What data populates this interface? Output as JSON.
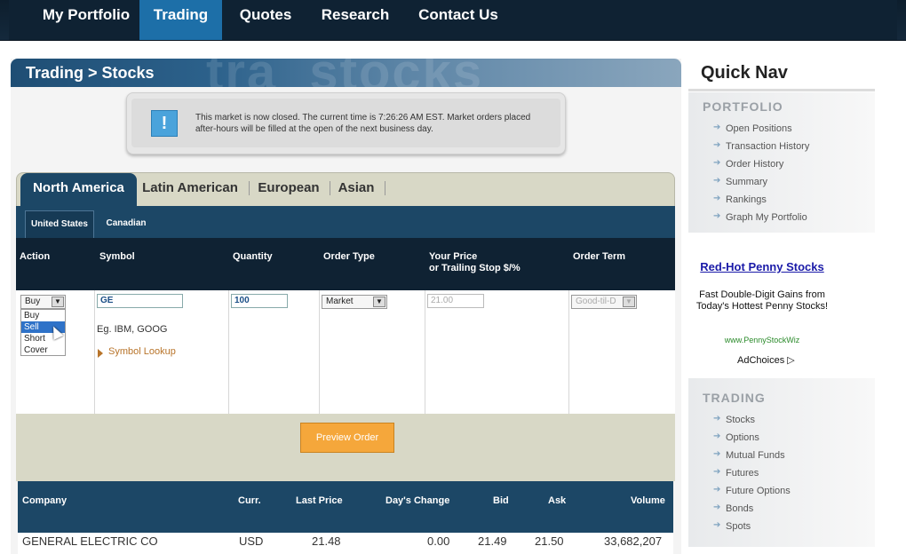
{
  "topnav": {
    "items": [
      {
        "label": "My Portfolio",
        "active": false
      },
      {
        "label": "Trading",
        "active": true
      },
      {
        "label": "Quotes",
        "active": false
      },
      {
        "label": "Research",
        "active": false
      },
      {
        "label": "Contact Us",
        "active": false
      }
    ]
  },
  "header": {
    "title": "Trading > Stocks"
  },
  "alert": {
    "icon": "!",
    "message": "This market is now closed. The current time is 7:26:26 AM EST. Market orders placed after-hours will be filled at the open of the next business day."
  },
  "regions": {
    "tabs": [
      "North America",
      "Latin American",
      "European",
      "Asian"
    ],
    "active": "North America"
  },
  "countries": {
    "tabs": [
      "United States",
      "Canadian"
    ],
    "active": "United States"
  },
  "order_form": {
    "columns": {
      "action": "Action",
      "symbol": "Symbol",
      "quantity": "Quantity",
      "order_type": "Order Type",
      "your_price_line1": "Your Price",
      "your_price_line2": "or Trailing Stop $/%",
      "order_term": "Order Term"
    },
    "action_value": "Buy",
    "action_options": [
      "Buy",
      "Sell",
      "Short",
      "Cover"
    ],
    "action_highlighted": "Sell",
    "symbol_value": "GE",
    "symbol_hint": "Eg. IBM, GOOG",
    "symbol_lookup": "Symbol Lookup",
    "quantity_value": "100",
    "order_type_value": "Market",
    "price_value": "21.00",
    "order_term_value": "Good-til-D",
    "preview_button": "Preview Order"
  },
  "quote_table": {
    "headers": [
      "Company",
      "Curr.",
      "Last Price",
      "Day's Change",
      "Bid",
      "Ask",
      "Volume"
    ],
    "rows": [
      [
        "GENERAL ELECTRIC CO",
        "USD",
        "21.48",
        "0.00",
        "21.49",
        "21.50",
        "33,682,207"
      ]
    ]
  },
  "sidebar": {
    "title": "Quick Nav",
    "portfolio": {
      "title": "PORTFOLIO",
      "links": [
        "Open Positions",
        "Transaction History",
        "Order History",
        "Summary",
        "Rankings",
        "Graph My Portfolio"
      ]
    },
    "ad": {
      "title": "Red-Hot Penny Stocks",
      "body": "Fast Double-Digit Gains from Today's Hottest Penny Stocks!",
      "url": "www.PennyStockWiz",
      "choices": "AdChoices ▷"
    },
    "trading": {
      "title": "TRADING",
      "links": [
        "Stocks",
        "Options",
        "Mutual Funds",
        "Futures",
        "Future Options",
        "Bonds",
        "Spots"
      ]
    }
  },
  "colors": {
    "nav_bg": "#0f2233",
    "nav_active": "#1d6fa8",
    "panel_blue": "#1c4766",
    "preview_orange": "#f5a73b"
  }
}
